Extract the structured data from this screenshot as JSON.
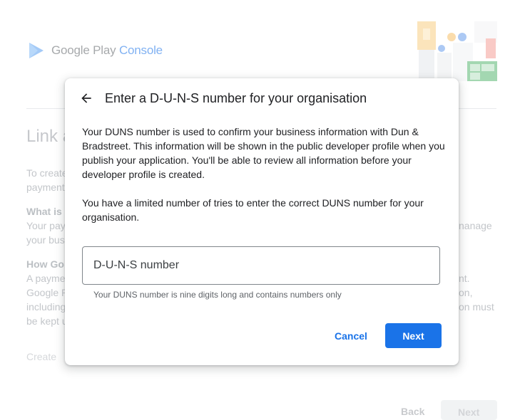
{
  "brand": {
    "name": "Google Play",
    "product": "Console"
  },
  "background_page": {
    "title_fragment": "Link a",
    "lines": [
      "To create",
      "payment",
      "What is",
      "Your pay",
      "your bus",
      "How Go",
      "A payme",
      "Google P",
      "including",
      "be kept u"
    ],
    "right_fragments": [
      "nanage",
      "nt.",
      "on,",
      "on must"
    ],
    "create_fragment": "Create",
    "back_label": "Back",
    "next_label": "Next"
  },
  "dialog": {
    "title": "Enter a D-U-N-S number for your organisation",
    "paragraph1": "Your DUNS number is used to confirm your business information with Dun & Bradstreet. This information will be shown in the public developer profile when you publish your application. You'll be able to review all information before your developer profile is created.",
    "paragraph2": "You have a limited number of tries to enter the correct DUNS number for your organisation.",
    "input": {
      "placeholder": "D-U-N-S number",
      "value": ""
    },
    "helper": "Your DUNS number is nine digits long and contains numbers only",
    "cancel_label": "Cancel",
    "next_label": "Next"
  },
  "colors": {
    "accent": "#1a73e8",
    "text": "#202124",
    "secondary_text": "#5f6368"
  }
}
